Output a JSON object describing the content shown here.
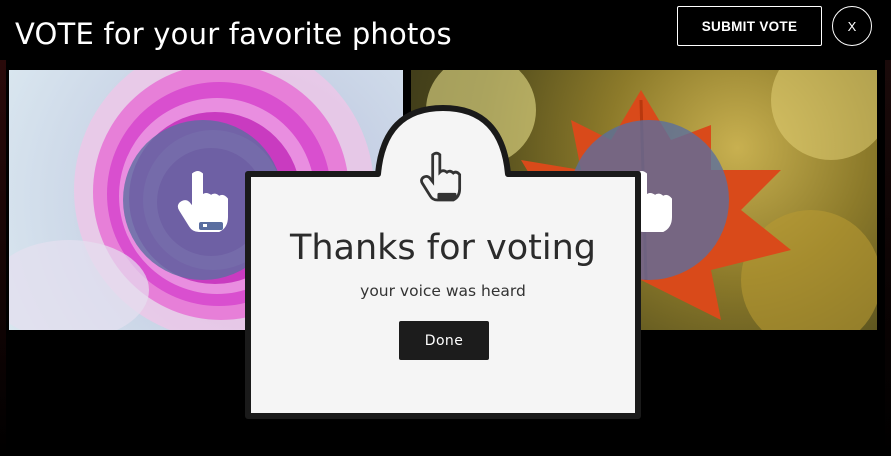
{
  "header": {
    "title": "VOTE for your favorite photos",
    "submit_label": "SUBMIT VOTE",
    "close_label": "X"
  },
  "photos": [
    {
      "subject": "pink ranunculus flower",
      "vote_icon": "hand-pointer-icon"
    },
    {
      "subject": "red maple leaf",
      "vote_icon": "hand-pointer-icon"
    }
  ],
  "modal": {
    "icon": "hand-pointer-icon",
    "title": "Thanks for voting",
    "subtitle": "your voice was heard",
    "done_label": "Done"
  },
  "colors": {
    "background": "#000000",
    "overlay_circle": "#5a6ea0",
    "modal_bg": "#f5f5f5",
    "modal_border": "#1a1a1a",
    "done_bg": "#1c1c1c"
  }
}
